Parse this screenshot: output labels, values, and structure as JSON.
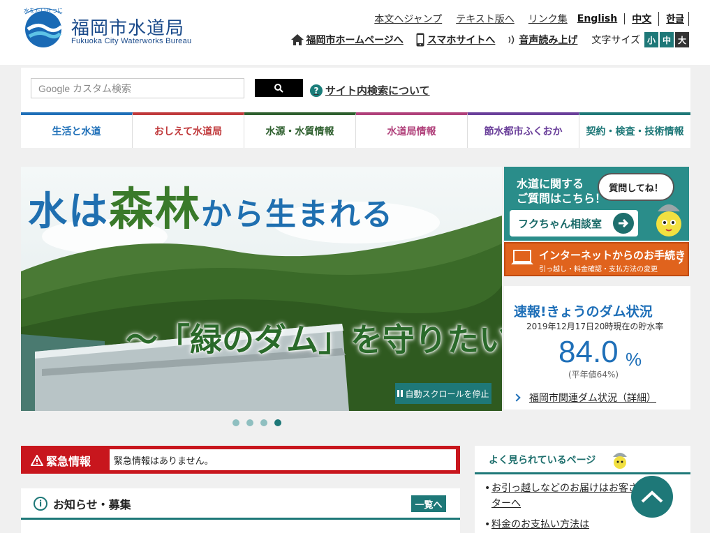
{
  "header": {
    "logo_tagline": "水をたいせつに",
    "logo_ja": "福岡市水道局",
    "logo_en": "Fukuoka City Waterworks Bureau",
    "util_links": [
      "本文へジャンプ",
      "テキスト版へ",
      "リンク集"
    ],
    "languages": [
      "English",
      "中文",
      "한글"
    ],
    "home_link": "福岡市ホームページへ",
    "smartphone_link": "スマホサイトへ",
    "voice_link": "音声読み上げ",
    "font_size_label": "文字サイズ",
    "font_sizes": [
      "小",
      "中",
      "大"
    ]
  },
  "search": {
    "placeholder": "Google カスタム検索",
    "help_link": "サイト内検索について"
  },
  "nav": [
    {
      "label": "生活と水道",
      "color": "#1e6fb8"
    },
    {
      "label": "おしえて水道局",
      "color": "#c0393b"
    },
    {
      "label": "水源・水質情報",
      "color": "#2e5f2e"
    },
    {
      "label": "水道局情報",
      "color": "#b0407a"
    },
    {
      "label": "節水都市ふくおか",
      "color": "#6a3f9a"
    },
    {
      "label": "契約・検査・技術情報",
      "color": "#1e7878"
    }
  ],
  "slider": {
    "title_part1": "水は",
    "title_part2": "森林",
    "title_part3": "から生まれる",
    "subtitle": "〜「緑のダム」を守りたい〜",
    "pause_label": "自動スクロールを停止",
    "slide_count": 4,
    "active_slide": 4
  },
  "banners": {
    "consult_text_line1": "水道に関する",
    "consult_text_line2": "ご質問はこちら！",
    "consult_bubble": "質問してね！",
    "consult_button": "フクちゃん相談室",
    "online_title": "インターネットからのお手続き",
    "online_sub": "引っ越し・料金確認・支払方法の変更"
  },
  "dam": {
    "title": "速報!きょうのダム状況",
    "date": "2019年12月17日20時現在の貯水率",
    "value": "84.0",
    "unit": "%",
    "average": "(平年値64%)",
    "link": "福岡市関連ダム状況（詳細）"
  },
  "emergency": {
    "label": "緊急情報",
    "message": "緊急情報はありません。"
  },
  "news": {
    "title": "お知らせ・募集",
    "more": "一覧へ"
  },
  "popular": {
    "title": "よく見られているページ",
    "items": [
      "お引っ越しなどのお届けはお客さまセンターへ",
      "料金のお支払い方法は"
    ]
  },
  "colors": {
    "accent": "#1e7878",
    "emergency": "#c8161d",
    "online": "#e0631d",
    "dam_blue": "#1e6fb8"
  }
}
